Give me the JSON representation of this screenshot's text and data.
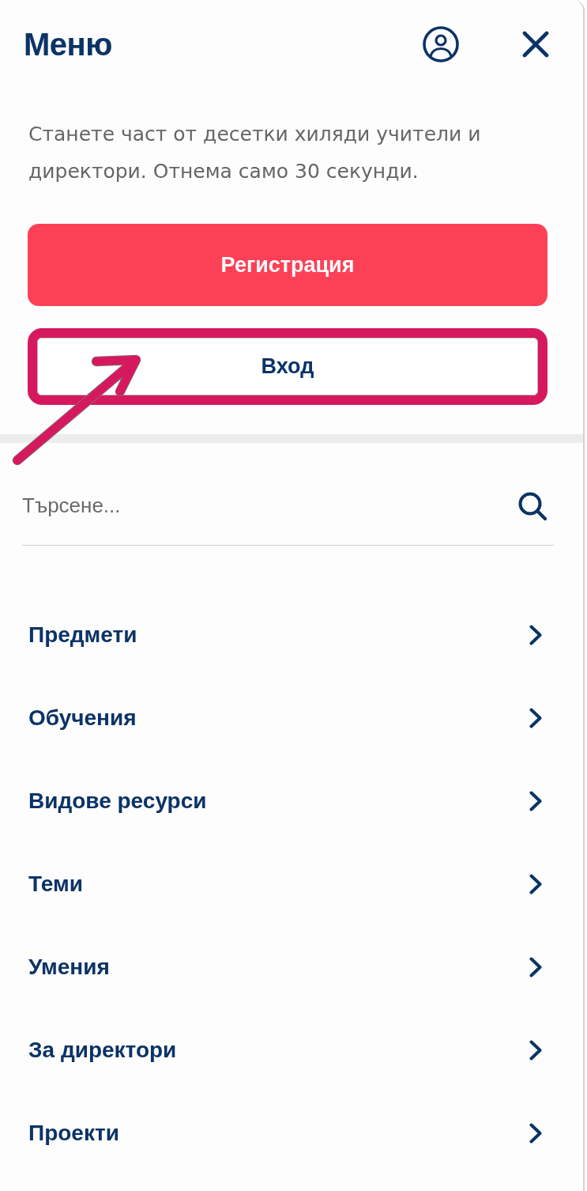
{
  "header": {
    "title": "Меню"
  },
  "intro": {
    "text": "Станете част от десетки хиляди учители и директори. Отнема само 30 секунди."
  },
  "buttons": [
    {
      "label": "Регистрация",
      "kind": "primary",
      "highlighted": false
    },
    {
      "label": "Вход",
      "kind": "secondary",
      "highlighted": true
    }
  ],
  "search": {
    "placeholder": "Търсене..."
  },
  "menu": {
    "items": [
      {
        "label": "Предмети"
      },
      {
        "label": "Обучения"
      },
      {
        "label": "Видове ресурси"
      },
      {
        "label": "Теми"
      },
      {
        "label": "Умения"
      },
      {
        "label": "За директори"
      },
      {
        "label": "Проекти"
      }
    ]
  }
}
